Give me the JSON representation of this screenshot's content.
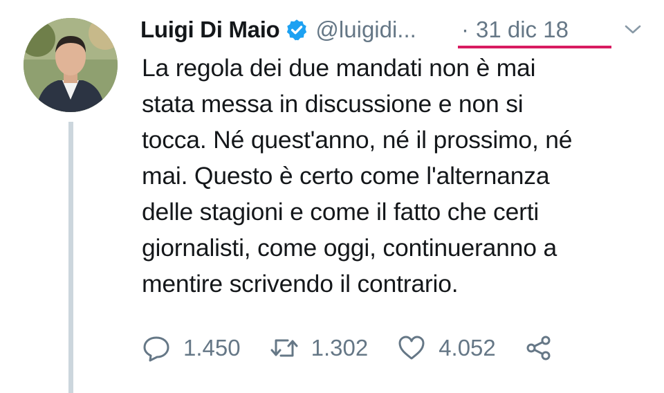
{
  "tweet": {
    "author_name": "Luigi Di Maio",
    "handle": "@luigidi...",
    "separator": "·",
    "date": "31 dic 18",
    "text": "La regola dei due mandati non è mai\nstata messa in discussione e non si\ntocca. Né quest'anno, né il prossimo, né\nmai. Questo è certo come l'alternanza\ndelle stagioni e come il fatto che certi\ngiornalisti, come oggi, continueranno a\nmentire scrivendo il contrario.",
    "verified": true
  },
  "actions": {
    "replies": "1.450",
    "retweets": "1.302",
    "likes": "4.052"
  },
  "icons": {
    "verified": "verified-badge-icon",
    "menu": "chevron-down-icon",
    "reply": "reply-icon",
    "retweet": "retweet-icon",
    "like": "heart-icon",
    "share": "share-icon"
  },
  "colors": {
    "text": "#14171a",
    "secondary": "#657786",
    "verified": "#1da1f2",
    "highlight_underline": "#d81b60",
    "thread_line": "#ccd6dd"
  }
}
